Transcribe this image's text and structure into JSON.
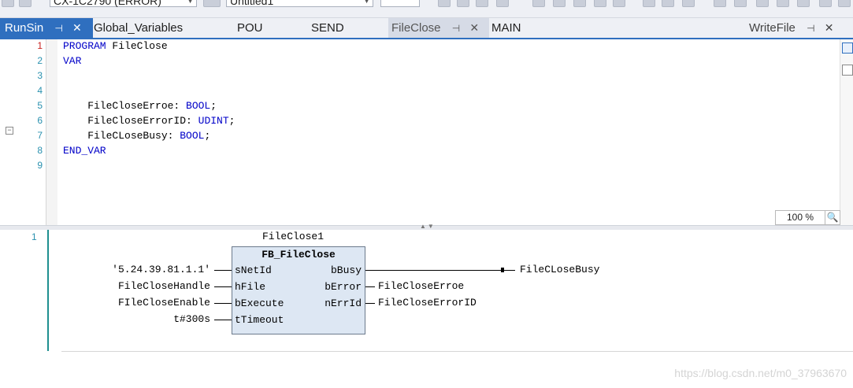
{
  "toolbar": {
    "target_combo": "CX-1C2790 (ERROR)",
    "solution_combo": "Untitled1"
  },
  "tabs": [
    {
      "label": "RunSin",
      "active": true
    },
    {
      "label": "Global_Variables"
    },
    {
      "label": "POU"
    },
    {
      "label": "SEND"
    },
    {
      "label": "FileClose",
      "selected_inactive": true
    },
    {
      "label": "MAIN"
    },
    {
      "label": "WriteFile"
    }
  ],
  "declaration": {
    "line_numbers": [
      "1",
      "2",
      "3",
      "4",
      "5",
      "6",
      "7",
      "8",
      "9"
    ],
    "lines": [
      {
        "kw": "PROGRAM",
        "rest": " FileClose"
      },
      {
        "kw": "VAR",
        "rest": ""
      },
      {
        "kw": "",
        "rest": ""
      },
      {
        "kw": "",
        "rest": ""
      },
      {
        "name": "    FileCloseErroe: ",
        "type": "BOOL",
        "end": ";"
      },
      {
        "name": "    FileCloseErrorID: ",
        "type": "UDINT",
        "end": ";"
      },
      {
        "name": "    FileCLoseBusy: ",
        "type": "BOOL",
        "end": ";"
      },
      {
        "kw": "END_VAR",
        "rest": ""
      },
      {
        "kw": "",
        "rest": ""
      }
    ],
    "zoom": "100 %"
  },
  "fbd": {
    "network_number": "1",
    "instance_name": "FileClose1",
    "block_type": "FB_FileClose",
    "inputs": [
      {
        "pin": "sNetId",
        "value": "'5.24.39.81.1.1'"
      },
      {
        "pin": "hFile",
        "value": "FileCloseHandle"
      },
      {
        "pin": "bExecute",
        "value": "FIleCloseEnable"
      },
      {
        "pin": "tTimeout",
        "value": "t#300s"
      }
    ],
    "outputs": [
      {
        "pin": "bBusy",
        "value": "FileCLoseBusy"
      },
      {
        "pin": "bError",
        "value": "FileCloseErroe"
      },
      {
        "pin": "nErrId",
        "value": "FileCloseErrorID"
      }
    ]
  },
  "watermark": "https://blog.csdn.net/m0_37963670"
}
